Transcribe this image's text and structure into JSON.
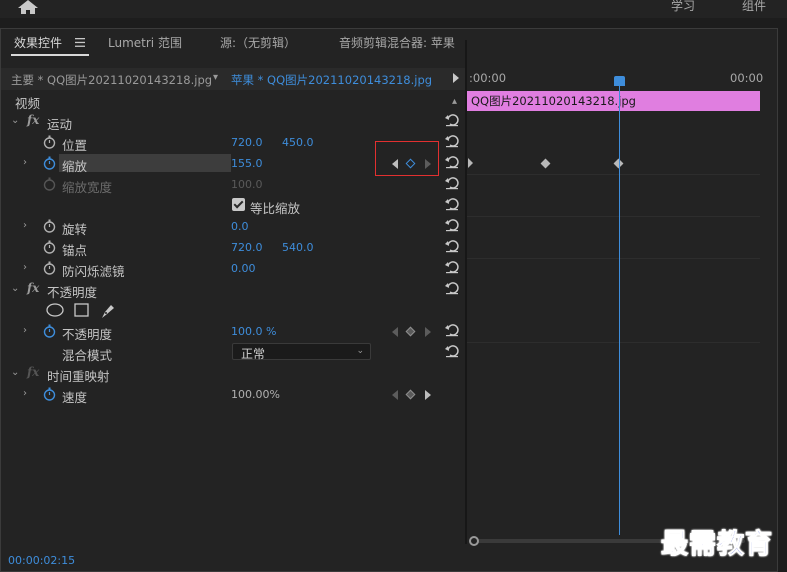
{
  "top_nav": {
    "learn": "学习",
    "assemble": "组件"
  },
  "tabs": [
    {
      "label": "效果控件"
    },
    {
      "label": "Lumetri 范围"
    },
    {
      "label": "源:（无剪辑）"
    },
    {
      "label": "音频剪辑混合器: 苹果"
    }
  ],
  "source_bar": {
    "main": "主要 * QQ图片20211020143218.jpg",
    "clip": "苹果 * QQ图片20211020143218.jpg"
  },
  "timeline": {
    "start_time": ":00:00",
    "end_time": "00:00",
    "clip_name": "QQ图片20211020143218.jpg"
  },
  "sections": {
    "video": "视频",
    "motion": "运动",
    "opacity_group": "不透明度",
    "time_remap": "时间重映射"
  },
  "params": {
    "position": {
      "label": "位置",
      "x": "720.0",
      "y": "450.0"
    },
    "scale": {
      "label": "缩放",
      "value": "155.0"
    },
    "scale_width": {
      "label": "缩放宽度",
      "value": "100.0"
    },
    "uniform_scale": {
      "label": "等比缩放"
    },
    "rotation": {
      "label": "旋转",
      "value": "0.0"
    },
    "anchor": {
      "label": "锚点",
      "x": "720.0",
      "y": "540.0"
    },
    "anti_flicker": {
      "label": "防闪烁滤镜",
      "value": "0.00"
    },
    "opacity": {
      "label": "不透明度",
      "value": "100.0 %"
    },
    "blend_mode": {
      "label": "混合模式",
      "value": "正常"
    },
    "speed": {
      "label": "速度",
      "value": "100.00%"
    }
  },
  "timecode": "00:00:02:15",
  "watermark": "最需教育",
  "colors": {
    "accent": "#3e8ddb",
    "clip": "#e07ee0",
    "highlight_box": "#e23030"
  },
  "icons": [
    "home-icon",
    "menu-icon",
    "reset-icon",
    "stopwatch-icon",
    "ellipse-mask-icon",
    "rect-mask-icon",
    "pen-mask-icon"
  ]
}
